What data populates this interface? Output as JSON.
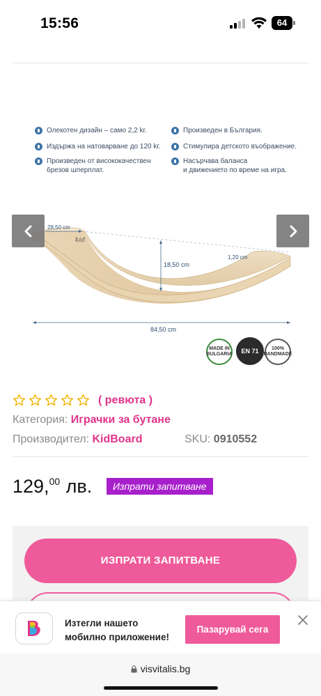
{
  "status_bar": {
    "time": "15:56",
    "battery": "64"
  },
  "gallery": {
    "features_left": [
      {
        "icon": "feather-icon",
        "lines": [
          "Олекотен дизайн – само 2,2 kг."
        ]
      },
      {
        "icon": "weight-icon",
        "lines": [
          "Издържа на натоварване до 120 kг."
        ]
      },
      {
        "icon": "quality-icon",
        "lines": [
          "Произведен от висококачествен",
          "брезов шперплат."
        ]
      }
    ],
    "features_right": [
      {
        "icon": "bulgaria-icon",
        "lines": [
          "Произведен в България."
        ]
      },
      {
        "icon": "imagination-icon",
        "lines": [
          "Стимулира детското въображение."
        ]
      },
      {
        "icon": "balance-icon",
        "lines": [
          "Насърчава баланса",
          "и движението по време на игра."
        ]
      }
    ],
    "dimensions": {
      "top_width": "28,50 cm",
      "height": "18,50 cm",
      "thickness": "1,20 cm",
      "length": "84,50 cm"
    },
    "brand_mark": "kid",
    "badges": [
      {
        "icon": "made-in-bulgaria-badge-icon",
        "text": "MADE IN BULGARIA"
      },
      {
        "icon": "en71-badge-icon",
        "text": "EN 71"
      },
      {
        "icon": "handmade-badge-icon",
        "text": "100% HANDMADE"
      }
    ]
  },
  "product": {
    "stars": 5,
    "reviews_label": "( ревюта )",
    "category_label": "Категория:",
    "category_value": "Играчки за бутане",
    "manufacturer_label": "Производител:",
    "manufacturer_value": "KidBoard",
    "sku_label": "SKU:",
    "sku_value": "0910552",
    "price_whole": "129,",
    "price_cents": "00",
    "price_currency": "лв.",
    "inquiry_tag": "Изпрати запитване",
    "cta_label": "ИЗПРАТИ ЗАПИТВАНЕ"
  },
  "app_banner": {
    "line1": "Изтегли нашето",
    "line2": "мобилно приложение!",
    "button": "Пазарувай сега"
  },
  "browser": {
    "url": "visvitalis.bg"
  },
  "colors": {
    "accent": "#ee5a9a",
    "link": "#e0348a",
    "tag": "#a81fcc",
    "star": "#f0b400"
  }
}
